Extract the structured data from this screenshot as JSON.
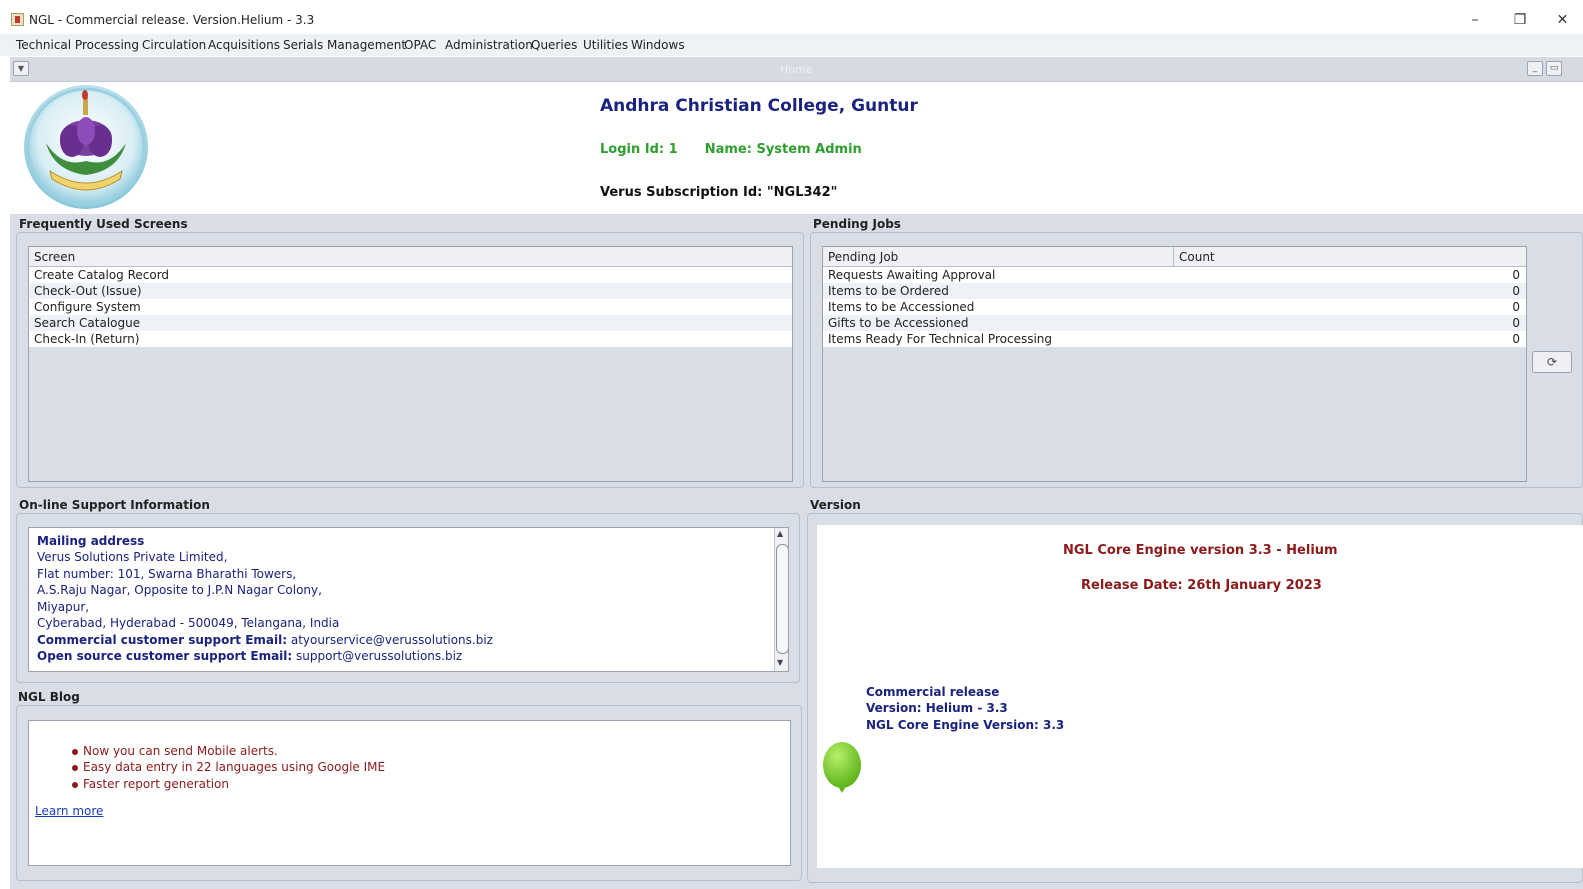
{
  "window": {
    "title": "NGL - Commercial release. Version.Helium - 3.3",
    "controls": [
      "–",
      "❐",
      "✕"
    ]
  },
  "menu": [
    "Technical Processing",
    "Circulation",
    "Acquisitions",
    "Serials Management",
    "OPAC",
    "Administration",
    "Queries",
    "Utilities",
    "Windows"
  ],
  "frame": {
    "title": "Home"
  },
  "header": {
    "college": "Andhra Christian College, Guntur",
    "login_id": "Login Id: 1",
    "name": "Name: System Admin",
    "subscription": "Verus Subscription Id: \"NGL342\""
  },
  "frequent": {
    "title": "Frequently Used Screens",
    "column": "Screen",
    "rows": [
      "Create Catalog Record",
      "Check-Out (Issue)",
      "Configure System",
      "Search Catalogue",
      "Check-In (Return)"
    ]
  },
  "pending": {
    "title": "Pending Jobs",
    "columns": [
      "Pending Job",
      "Count"
    ],
    "rows": [
      {
        "job": "Requests Awaiting Approval",
        "count": "0"
      },
      {
        "job": "Items to be Ordered",
        "count": "0"
      },
      {
        "job": "Items to be Accessioned",
        "count": "0"
      },
      {
        "job": "Gifts to be Accessioned",
        "count": "0"
      },
      {
        "job": "Items Ready For Technical Processing",
        "count": "0"
      }
    ]
  },
  "support": {
    "title": "On-line Support Information",
    "mailing_label": "Mailing address",
    "address": [
      "Verus Solutions Private Limited,",
      "Flat number: 101, Swarna Bharathi Towers,",
      "A.S.Raju Nagar, Opposite to J.P.N Nagar Colony,",
      "Miyapur,",
      "Cyberabad, Hyderabad - 500049, Telangana, India"
    ],
    "commercial_label": "Commercial customer support Email:",
    "commercial_email": "atyourservice@verussolutions.biz",
    "open_label": "Open source customer support Email:",
    "open_email": "support@verussolutions.biz"
  },
  "blog": {
    "title": "NGL Blog",
    "items": [
      "Now you can send Mobile alerts.",
      "Easy data entry in 22 languages using Google IME",
      "Faster report generation"
    ],
    "learn_more": "Learn more"
  },
  "version": {
    "title": "Version",
    "engine": "NGL Core Engine version 3.3 - Helium",
    "release_date": "Release Date: 26th January 2023",
    "info": [
      "Commercial release",
      "Version: Helium - 3.3",
      "NGL Core Engine Version: 3.3"
    ]
  },
  "colors": {
    "accent_blue": "#1a237e",
    "login_green": "#2e9e2e",
    "version_red": "#8b1a1a",
    "balloon": "#7ed321"
  },
  "icons": [
    "app-icon",
    "frame-menu-icon",
    "minimize-icon",
    "restore-icon",
    "close-icon",
    "refresh-icon",
    "scroll-up-icon",
    "scroll-down-icon",
    "balloon-icon",
    "college-logo"
  ]
}
